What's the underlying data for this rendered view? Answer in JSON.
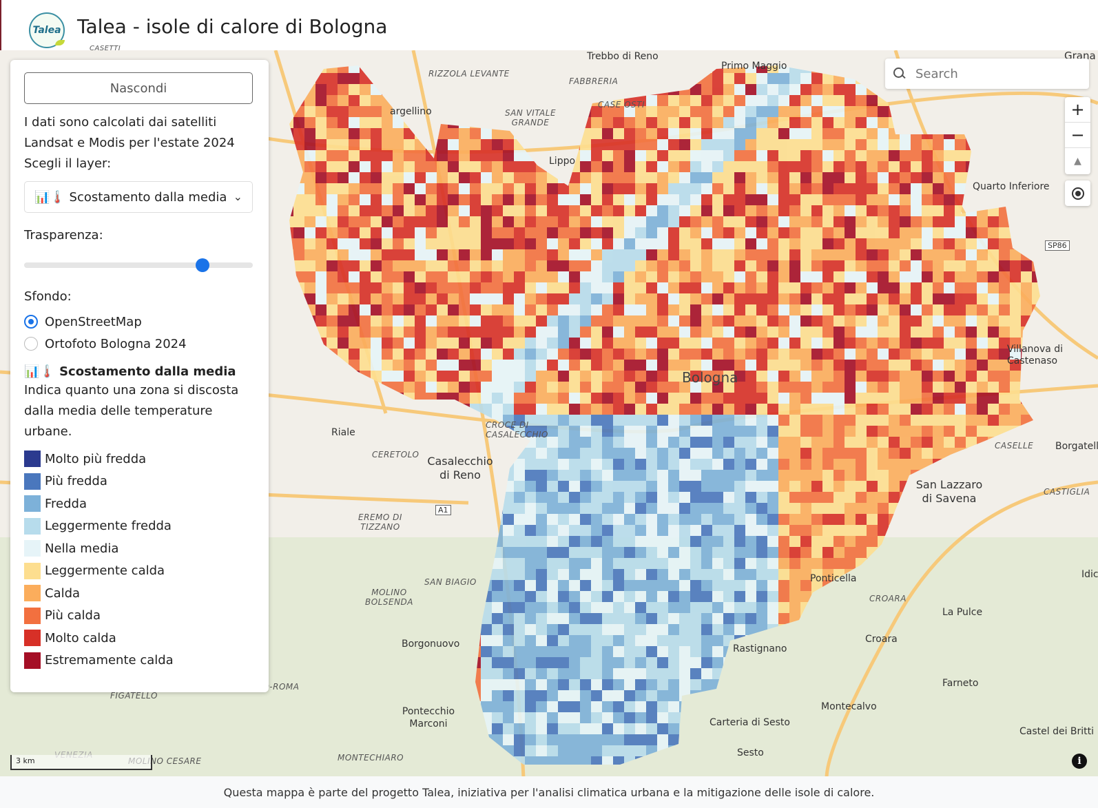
{
  "header": {
    "logo_text": "Talea",
    "title": "Talea - isole di calore di Bologna"
  },
  "panel": {
    "hide_label": "Nascondi",
    "intro_line1": "I dati sono calcolati dai satelliti",
    "intro_line2": "Landsat e Modis per l'estate 2024",
    "intro_line3": "Scegli il layer:",
    "layer_select": "📊🌡️ Scostamento dalla media",
    "transparency_label": "Trasparenza:",
    "transparency_value": 0.78,
    "background_label": "Sfondo:",
    "backgrounds": [
      {
        "label": "OpenStreetMap",
        "selected": true
      },
      {
        "label": "Ortofoto Bologna 2024",
        "selected": false
      }
    ],
    "legend_title": "📊🌡️ Scostamento dalla media",
    "legend_desc": "Indica quanto una zona si discosta dalla media delle temperature urbane.",
    "legend": [
      {
        "label": "Molto più fredda",
        "color": "#2b3a8f"
      },
      {
        "label": "Più fredda",
        "color": "#4a77bd"
      },
      {
        "label": "Fredda",
        "color": "#7db1d9"
      },
      {
        "label": "Leggermente fredda",
        "color": "#b7dcec"
      },
      {
        "label": "Nella media",
        "color": "#e6f4f8"
      },
      {
        "label": "Leggermente calda",
        "color": "#fdde8f"
      },
      {
        "label": "Calda",
        "color": "#fbad5c"
      },
      {
        "label": "Più calda",
        "color": "#f2703f"
      },
      {
        "label": "Molto calda",
        "color": "#d73027"
      },
      {
        "label": "Estremamente calda",
        "color": "#a50f26"
      }
    ]
  },
  "search": {
    "placeholder": "Search"
  },
  "controls": {
    "zoom_in": "+",
    "zoom_out": "−",
    "compass": "▲",
    "info": "i"
  },
  "scale": {
    "label": "3 km"
  },
  "map_labels": [
    "Trebbo di Reno",
    "Primo Maggio",
    "Grana",
    "RIZZOLA LEVANTE",
    "FABBRERIA",
    "CASE OSTI",
    "SAN VITALE GRANDE",
    "argellino",
    "Lippo",
    "Quarto Inferiore",
    "SP86",
    "Bologna",
    "Villanova di Castenaso",
    "Riale",
    "CROCE DI CASALECCHIO",
    "CERETOLO",
    "Casalecchio di Reno",
    "CASELLE",
    "Borgatella",
    "San Lazzaro di Savena",
    "CASTIGLIA",
    "A1",
    "EREMO DI TIZZANO",
    "Ponticella",
    "CROARA",
    "La Pulce",
    "SAN BIAGIO",
    "MOLINO BOLSENDA",
    "Croara",
    "Borgonuovo",
    "Rastignano",
    "Farneto",
    "FIGATELLO",
    "TIGNANO-ROMA",
    "Montecalvo",
    "Pontecchio Marconi",
    "Carteria di Sesto",
    "Castel dei Britti",
    "Sesto",
    "MONTECHIARO",
    "MOLINO CESARE",
    "VENEZIA",
    "CASETTI",
    "Idice"
  ],
  "footer": {
    "text": "Questa mappa è parte del progetto Talea, iniziativa per l'analisi climatica urbana e la mitigazione delle isole di calore."
  }
}
